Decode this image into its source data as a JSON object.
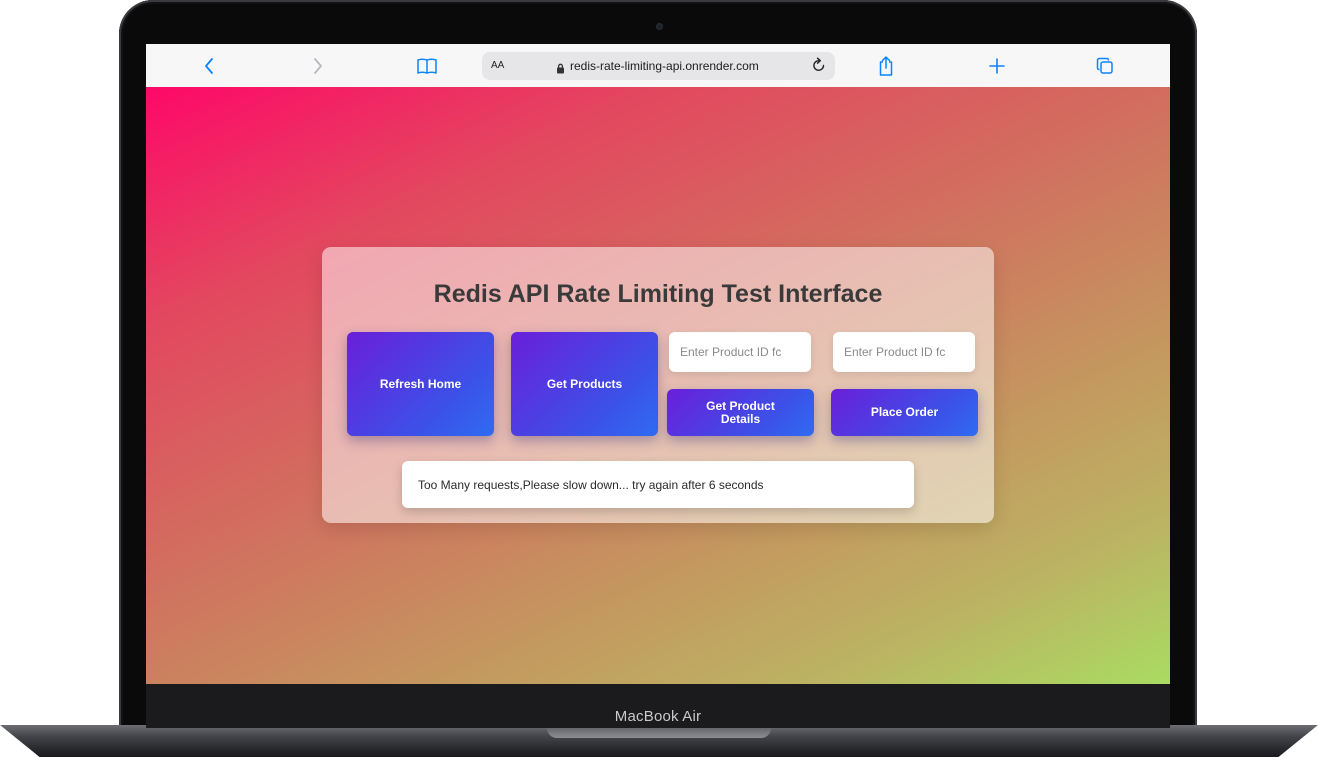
{
  "device": {
    "label": "MacBook Air"
  },
  "browser": {
    "text_size_label": "AA",
    "url": "redis-rate-limiting-api.onrender.com",
    "icons": {
      "back": "chevron-left-icon",
      "forward": "chevron-right-icon",
      "bookmarks": "book-icon",
      "lock": "lock-icon",
      "reload": "reload-icon",
      "share": "share-icon",
      "new_tab": "plus-icon",
      "tabs": "tabs-icon"
    },
    "accent_color": "#0a84ff"
  },
  "app": {
    "title": "Redis API Rate Limiting Test Interface",
    "buttons": {
      "refresh_home": "Refresh Home",
      "get_products": "Get Products",
      "get_product_details": "Get Product Details",
      "place_order": "Place Order"
    },
    "inputs": {
      "product_details_placeholder": "Enter Product ID fc",
      "place_order_placeholder": "Enter Product ID fc"
    },
    "message": "Too Many requests,Please slow down... try again after 6 seconds",
    "colors": {
      "button_gradient_start": "#6a1fd9",
      "button_gradient_end": "#2f6cf2",
      "background_start": "#fe0868",
      "background_end": "#a9dc62"
    }
  }
}
